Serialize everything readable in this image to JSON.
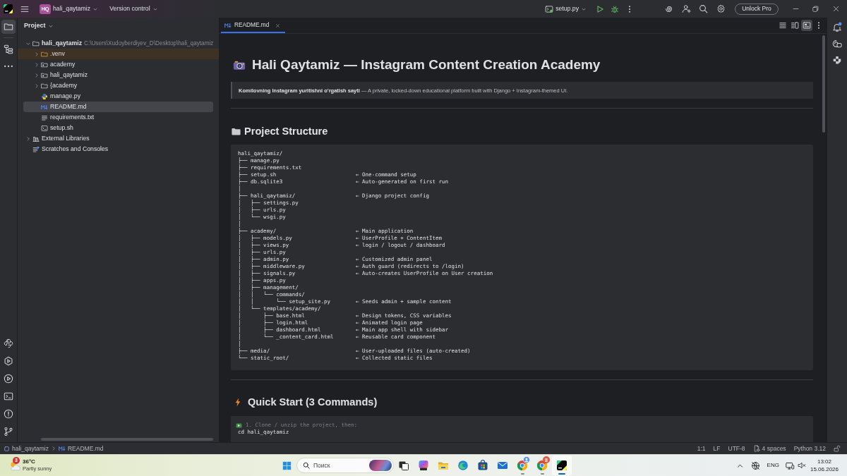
{
  "title_bar": {
    "project_badge": "HQ",
    "project_name": "hali_qaytamiz",
    "vcs_menu": "Version control",
    "run_config": "setup.py",
    "upgrade_button": "Unlock Pro"
  },
  "tool_strip": {
    "top": [
      {
        "kind": "project",
        "selected": true
      },
      {
        "kind": "structure",
        "selected": false
      },
      {
        "kind": "more",
        "selected": false
      }
    ],
    "bottom": [
      {
        "kind": "python-console",
        "selected": false
      },
      {
        "kind": "services",
        "selected": false
      },
      {
        "kind": "run",
        "selected": false
      },
      {
        "kind": "terminal",
        "selected": false
      },
      {
        "kind": "problems",
        "selected": false
      },
      {
        "kind": "git",
        "selected": false
      }
    ]
  },
  "project_panel": {
    "title": "Project",
    "tree": [
      {
        "name": "hali_qaytamiz",
        "path": "C:\\Users\\Xudoyberdiyev_D\\Desktop\\hali_qaytamiz",
        "kind": "project-root",
        "expanded": true,
        "selected": false,
        "children": [
          {
            "name": ".venv",
            "kind": "excluded-folder",
            "expanded": false,
            "selected": false
          },
          {
            "name": "academy",
            "kind": "package",
            "expanded": false,
            "selected": false
          },
          {
            "name": "hali_qaytamiz",
            "kind": "package",
            "expanded": false,
            "selected": false
          },
          {
            "name": "{academy",
            "kind": "folder",
            "expanded": false,
            "selected": false
          },
          {
            "name": "manage.py",
            "kind": "python",
            "selected": false
          },
          {
            "name": "README.md",
            "kind": "markdown",
            "selected": true
          },
          {
            "name": "requirements.txt",
            "kind": "text",
            "selected": false
          },
          {
            "name": "setup.sh",
            "kind": "shell",
            "selected": false
          }
        ]
      },
      {
        "name": "External Libraries",
        "kind": "libraries",
        "expanded": false,
        "selected": false
      },
      {
        "name": "Scratches and Consoles",
        "kind": "scratches",
        "selected": false
      }
    ]
  },
  "editor": {
    "tabs": [
      {
        "label": "README.md",
        "kind": "markdown",
        "selected": true
      }
    ],
    "view_modes": [
      {
        "kind": "editor",
        "selected": false
      },
      {
        "kind": "split",
        "selected": false
      },
      {
        "kind": "preview",
        "selected": true
      }
    ],
    "document": {
      "title": "Hali Qaytamiz — Instagram Content Creation Academy",
      "intro": "**Komilovning Instagram yuritishni o'rgatish sayti** — A private, locked-down educational platform built with Django + Instagram-themed UI.",
      "sections": [
        {
          "kind": "structure",
          "heading": "Project Structure",
          "lines": [
            {
              "path": "hali_qaytamiz/"
            },
            {
              "path": "├── manage.py"
            },
            {
              "path": "├── requirements.txt"
            },
            {
              "path": "├── setup.sh",
              "note": "← One-command setup"
            },
            {
              "path": "├── db.sqlite3",
              "note": "← Auto-generated on first run"
            },
            {
              "path": "│"
            },
            {
              "path": "├── hali_qaytamiz/",
              "note": "← Django project config"
            },
            {
              "path": "│   ├── settings.py"
            },
            {
              "path": "│   ├── urls.py"
            },
            {
              "path": "│   └── wsgi.py"
            },
            {
              "path": "│"
            },
            {
              "path": "├── academy/",
              "note": "← Main application"
            },
            {
              "path": "│   ├── models.py",
              "note": "← UserProfile + ContentItem"
            },
            {
              "path": "│   ├── views.py",
              "note": "← login / logout / dashboard"
            },
            {
              "path": "│   ├── urls.py"
            },
            {
              "path": "│   ├── admin.py",
              "note": "← Customized admin panel"
            },
            {
              "path": "│   ├── middleware.py",
              "note": "← Auth guard (redirects to /login)"
            },
            {
              "path": "│   ├── signals.py",
              "note": "← Auto-creates UserProfile on User creation"
            },
            {
              "path": "│   ├── apps.py"
            },
            {
              "path": "│   ├── management/"
            },
            {
              "path": "│   │   └── commands/"
            },
            {
              "path": "│   │       └── setup_site.py",
              "note": "← Seeds admin + sample content"
            },
            {
              "path": "│   └── templates/academy/"
            },
            {
              "path": "│       ├── base.html",
              "note": "← Design tokens, CSS variables"
            },
            {
              "path": "│       ├── login.html",
              "note": "← Animated login page"
            },
            {
              "path": "│       ├── dashboard.html",
              "note": "← Main app shell with sidebar"
            },
            {
              "path": "│       └── _content_card.html",
              "note": "← Reusable card component"
            },
            {
              "path": "│"
            },
            {
              "path": "├── media/",
              "note": "← User-uploaded files (auto-created)"
            },
            {
              "path": "└── static_root/",
              "note": "← Collected static files"
            }
          ]
        },
        {
          "kind": "commands",
          "heading": "Quick Start (3 Commands)",
          "lines": [
            {
              "kind": "comment",
              "text": "1. Clone / unzip the project, then:"
            },
            {
              "kind": "command",
              "text": "cd hali_qaytamiz"
            }
          ]
        }
      ]
    }
  },
  "status_bar": {
    "breadcrumbs": [
      {
        "kind": "project",
        "label": "hali_qaytamiz"
      },
      {
        "kind": "markdown",
        "label": "README.md"
      }
    ],
    "items": [
      {
        "kind": "position",
        "label": "1:1"
      },
      {
        "kind": "line-separator",
        "label": "LF"
      },
      {
        "kind": "encoding",
        "label": "UTF-8"
      },
      {
        "kind": "indent",
        "label": "4 spaces"
      },
      {
        "kind": "interpreter",
        "label": "Python 3.12"
      }
    ]
  },
  "taskbar": {
    "weather": {
      "badge": "3",
      "temperature": "36°C",
      "condition": "Partly sunny"
    },
    "search": {
      "placeholder": "Поиск"
    },
    "apps": [
      {
        "kind": "task-view",
        "running": false,
        "active": false
      },
      {
        "kind": "app-launcher",
        "running": false,
        "active": false
      },
      {
        "kind": "folder",
        "running": false,
        "active": false
      },
      {
        "kind": "browser-swirl",
        "running": false,
        "active": false
      },
      {
        "kind": "store",
        "running": false,
        "active": false
      },
      {
        "kind": "mail",
        "running": false,
        "active": false
      },
      {
        "kind": "browser-circle",
        "avatar": true,
        "running": true,
        "active": false
      },
      {
        "kind": "browser-circle",
        "badge": "8",
        "running": true,
        "active": false
      },
      {
        "kind": "ide",
        "running": true,
        "active": true
      }
    ],
    "language": "ENG",
    "time": "13:02",
    "date": "15.06.2026"
  }
}
